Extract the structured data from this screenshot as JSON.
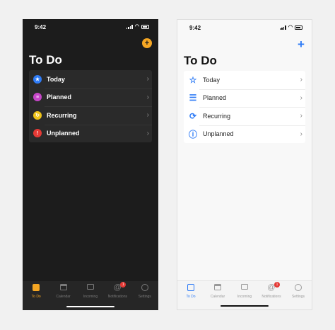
{
  "status": {
    "time": "9:42"
  },
  "header": {
    "title": "To Do",
    "add_glyph": "+"
  },
  "lists": [
    {
      "label": "Today",
      "icon": "star-icon",
      "color": "#2f7cf6"
    },
    {
      "label": "Planned",
      "icon": "list-icon",
      "color": "#c646c8"
    },
    {
      "label": "Recurring",
      "icon": "recurring-icon",
      "color": "#f0c419"
    },
    {
      "label": "Unplanned",
      "icon": "exclamation-icon",
      "color": "#e53935"
    }
  ],
  "tabs": [
    {
      "label": "To Do",
      "icon": "todo-icon"
    },
    {
      "label": "Calendar",
      "icon": "calendar-icon"
    },
    {
      "label": "Incoming",
      "icon": "inbox-icon"
    },
    {
      "label": "Notifications",
      "icon": "at-icon",
      "badge": "1"
    },
    {
      "label": "Settings",
      "icon": "gear-icon"
    }
  ],
  "colors": {
    "dark_accent": "#f5a623",
    "light_accent": "#2f7cf6",
    "badge": "#e53935"
  }
}
